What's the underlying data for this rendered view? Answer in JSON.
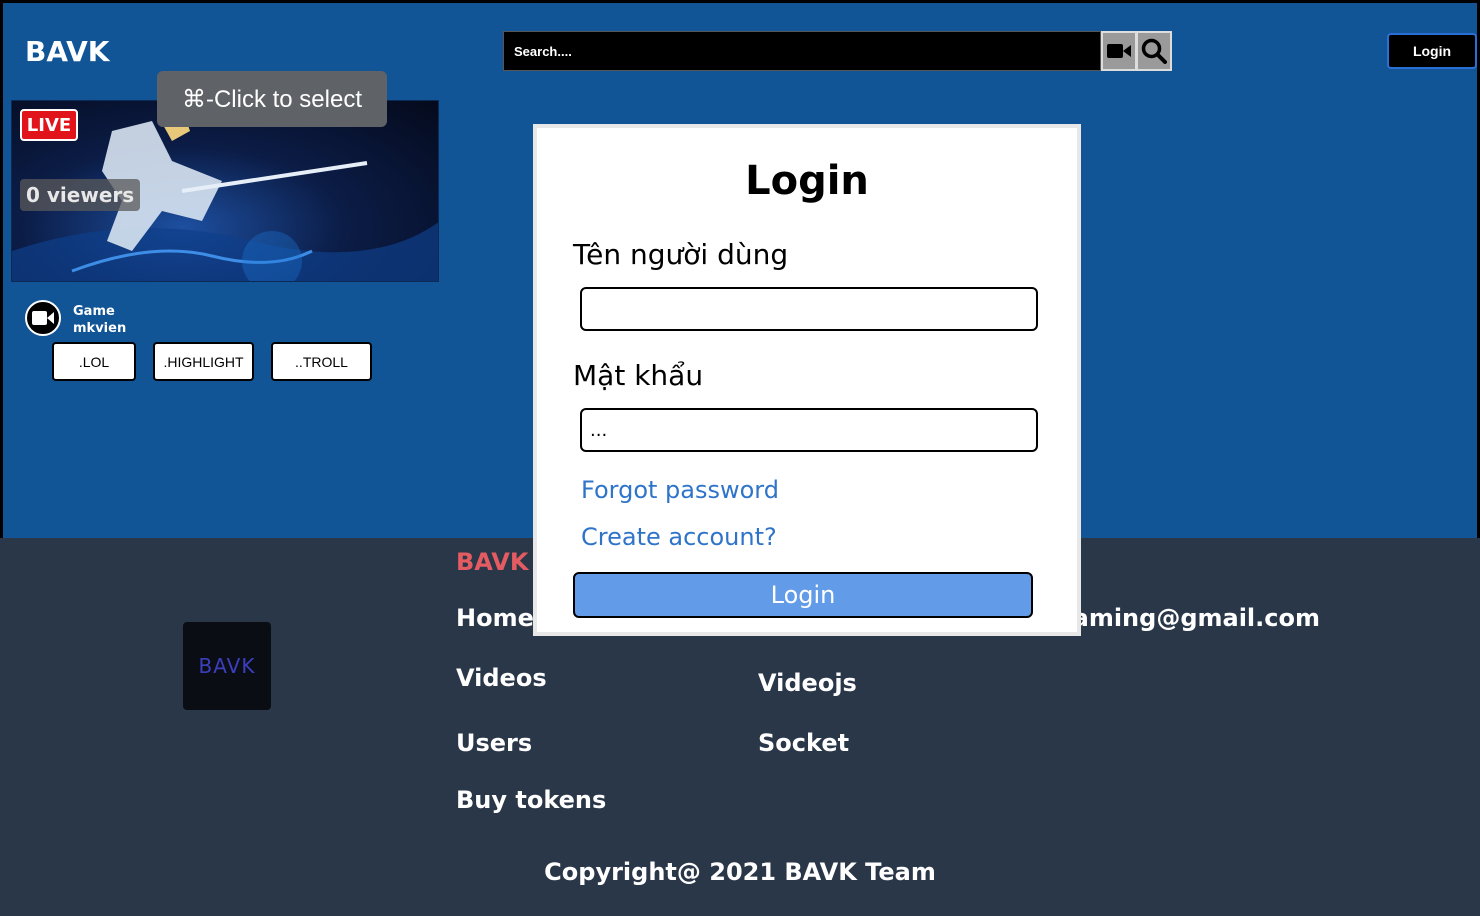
{
  "header": {
    "brand": "BAVK",
    "search_placeholder": "Search....",
    "camera_icon": "video-camera-icon",
    "search_icon": "magnifier-icon",
    "login_label": "Login"
  },
  "tooltip": {
    "text": "⌘-Click to select"
  },
  "stream_card": {
    "live_label": "LIVE",
    "viewers_label": "0 viewers",
    "category": "Game",
    "streamer": "mkvien",
    "tags": [
      ".LOL",
      ".HIGHLIGHT",
      "..TROLL"
    ]
  },
  "login_modal": {
    "title": "Login",
    "username_label": "Tên người dùng",
    "username_value": "",
    "password_label": "Mật khẩu",
    "password_value": "...",
    "forgot_password": "Forgot password",
    "create_account": "Create account?",
    "submit_label": "Login"
  },
  "footer": {
    "logo_text": "BAVK",
    "heading": "BAVK",
    "links_col1": [
      "Home",
      "Videos",
      "Users",
      "Buy tokens"
    ],
    "links_col2": [
      "Videojs",
      "Socket"
    ],
    "email_partial": "eaming@gmail.com",
    "copyright": "Copyright@ 2021 BAVK Team"
  },
  "colors": {
    "main_bg": "#125597",
    "footer_bg": "#2a3748",
    "accent_link": "#2f74c9",
    "submit_bg": "#629be8",
    "live_red": "#e1141b",
    "footer_heading": "#e55b62"
  }
}
